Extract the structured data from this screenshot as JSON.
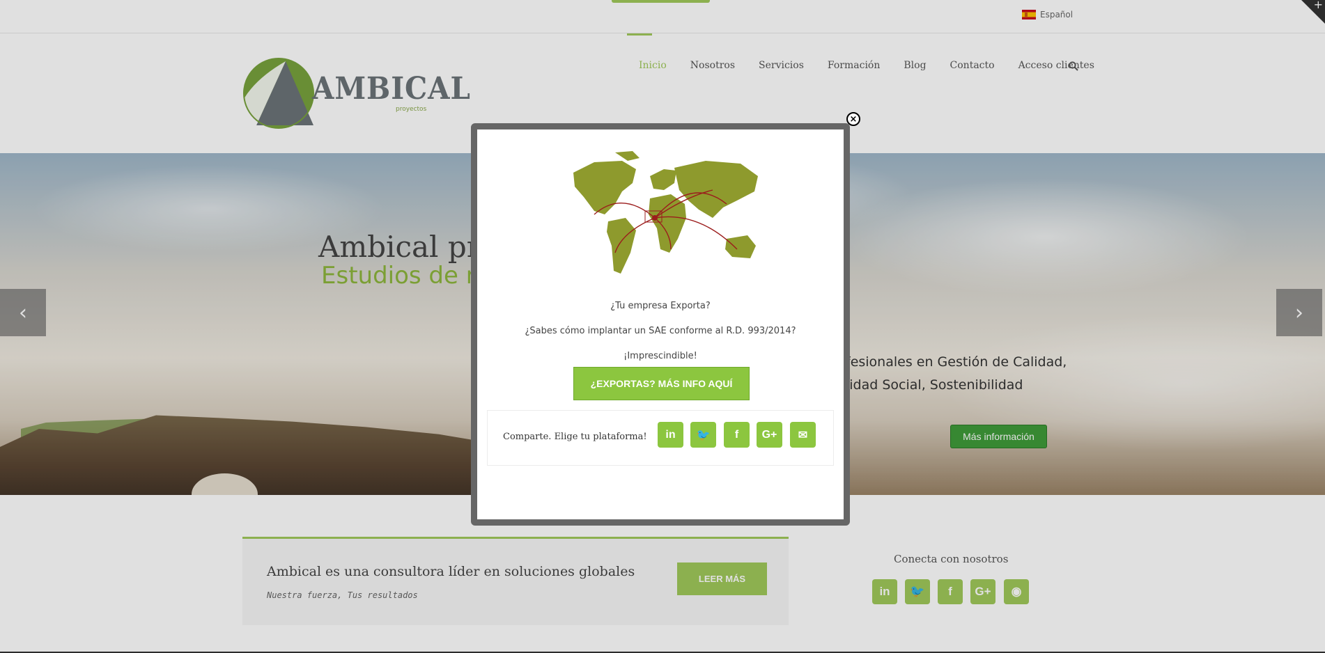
{
  "topbar": {
    "language": "Español"
  },
  "logo": {
    "word": "AMBICAL",
    "sub": "proyectos"
  },
  "nav": {
    "items": [
      "Inicio",
      "Nosotros",
      "Servicios",
      "Formación",
      "Blog",
      "Contacto",
      "Acceso clientes"
    ],
    "active_index": 0
  },
  "slider": {
    "title": "Ambical pro",
    "subtitle": "Estudios de r",
    "text_line1": "fesionales en Gestión de Calidad,",
    "text_line2": "lidad Social, Sostenibilidad",
    "button": "Más información",
    "prev_icon": "‹",
    "next_icon": "›"
  },
  "callout": {
    "title": "Ambical es una consultora líder en soluciones globales",
    "subtitle": "Nuestra fuerza, Tus resultados",
    "button": "LEER MÁS"
  },
  "connect": {
    "title": "Conecta con nosotros",
    "icons": [
      "linkedin-icon",
      "twitter-icon",
      "facebook-icon",
      "google-plus-icon",
      "rss-icon"
    ],
    "glyphs": [
      "in",
      "🐦",
      "f",
      "G+",
      "◉"
    ]
  },
  "modal": {
    "close_glyph": "×",
    "line1": "¿Tu empresa Exporta?",
    "line2": "¿Sabes cómo implantar un SAE conforme al R.D. 993/2014?",
    "line3": "¡Imprescindible!",
    "button": "¿EXPORTAS? MÁS INFO AQUÍ",
    "share_label": "Comparte. Elige tu plataforma!",
    "share_icons": [
      "linkedin-icon",
      "twitter-icon",
      "facebook-icon",
      "google-plus-icon",
      "email-icon"
    ],
    "share_glyphs": [
      "in",
      "🐦",
      "f",
      "G+",
      "✉"
    ]
  },
  "colors": {
    "accent": "#a0c95a",
    "modal_button": "#8cc63f",
    "slider_button": "#3f9b3a",
    "map_land": "#8e9a2d",
    "map_routes": "#9b1c1c"
  }
}
